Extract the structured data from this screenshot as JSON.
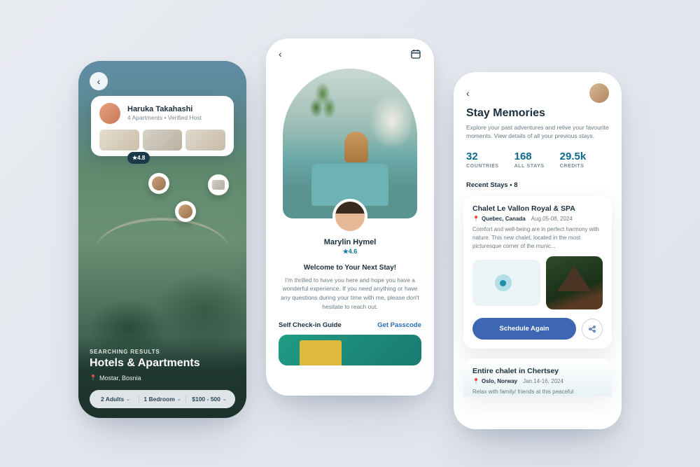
{
  "phone1": {
    "host_name": "Haruka Takahashi",
    "host_meta": "4 Apartments  •  Verified Host",
    "rating": "★4.8",
    "kicker": "SEARCHING RESULTS",
    "title": "Hotels & Apartments",
    "location": "Mostar, Bosnia",
    "filter_guests": "2 Adults",
    "filter_rooms": "1 Bedroom",
    "filter_price": "$100 - 500"
  },
  "phone2": {
    "host_name": "Marylin Hymel",
    "rating": "★4.6",
    "welcome": "Welcome to Your Next Stay!",
    "desc": "I'm thrilled to have you here and hope you have a wonderful experience. If you need anything or have any questions during your time with me, please don't hesitate to reach out.",
    "guide_label": "Self Check-in Guide",
    "passcode_label": "Get Passcode"
  },
  "phone3": {
    "title": "Stay Memories",
    "subtitle": "Explore your past adventures and relive your favourite moments. View details of all your previous stays.",
    "stat1_val": "32",
    "stat1_lbl": "COUNTRIES",
    "stat2_val": "168",
    "stat2_lbl": "ALL STAYS",
    "stat3_val": "29.5k",
    "stat3_lbl": "CREDITS",
    "section": "Recent Stays  •  8",
    "card1_title": "Chalet Le Vallon Royal & SPA",
    "card1_loc": "Quebec, Canada",
    "card1_date": "Aug.05-08, 2024",
    "card1_text": "Comfort and well-being are in perfect harmony with nature. This new chalet, located in the most picturesque corner of the munic...",
    "schedule_btn": "Schedule Again",
    "card2_title": "Entire chalet in Chertsey",
    "card2_loc": "Oslo, Norway",
    "card2_date": "Jan.14-16, 2024",
    "card2_text": "Relax with family/ friends at this peaceful"
  }
}
